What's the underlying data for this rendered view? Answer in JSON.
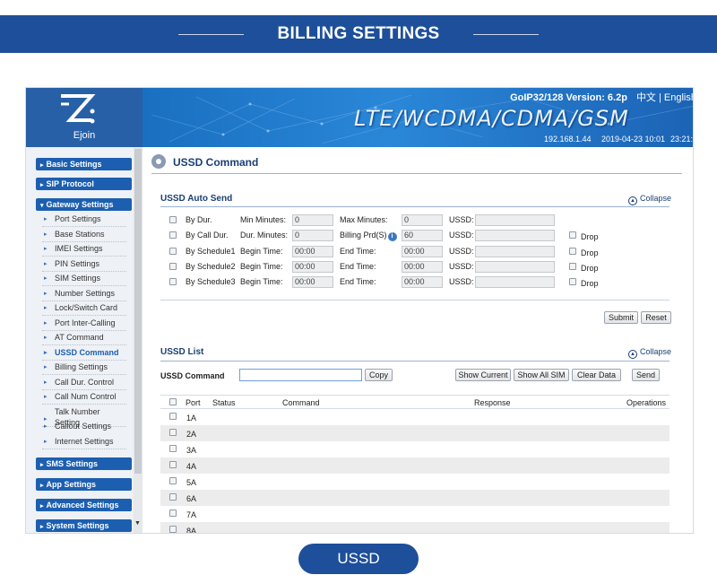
{
  "banner": {
    "title": "BILLING SETTINGS"
  },
  "footer_pill": {
    "label": "USSD"
  },
  "logo": {
    "name": "Ejoin"
  },
  "header": {
    "version": "GoIP32/128 Version: 6.2p",
    "lang": "中文 | English",
    "tech": "LTE/WCDMA/CDMA/GSM",
    "ip": "192.168.1.44",
    "date": "2019-04-23 10:01",
    "time": "23:21:"
  },
  "sidebar": {
    "categories": {
      "basic": "Basic Settings",
      "sip": "SIP Protocol",
      "gateway": "Gateway Settings",
      "sms": "SMS Settings",
      "app": "App Settings",
      "advanced": "Advanced Settings",
      "system": "System Settings"
    },
    "items": [
      "Port Settings",
      "Base Stations",
      "IMEI Settings",
      "PIN Settings",
      "SIM Settings",
      "Number Settings",
      "Lock/Switch Card",
      "Port Inter-Calling",
      "AT Command",
      "USSD Command",
      "Billing Settings",
      "Call Dur. Control",
      "Call Num Control",
      "Talk Number",
      "Setting",
      "Callout Settings",
      "Internet Settings"
    ]
  },
  "main": {
    "title": "USSD Command",
    "auto_send": {
      "title": "USSD Auto Send",
      "collapse": "Collapse",
      "rows": [
        {
          "name": "By Dur.",
          "l1": "Min Minutes:",
          "v1": "0",
          "l2": "Max Minutes:",
          "v2": "0",
          "ussd": "USSD:",
          "drop": ""
        },
        {
          "name": "By Call Dur.",
          "l1": "Dur. Minutes:",
          "v1": "0",
          "l2": "Billing Prd(S)",
          "v2": "60",
          "ussd": "USSD:",
          "drop": "Drop"
        },
        {
          "name": "By Schedule1",
          "l1": "Begin Time:",
          "v1": "00:00",
          "l2": "End Time:",
          "v2": "00:00",
          "ussd": "USSD:",
          "drop": "Drop"
        },
        {
          "name": "By Schedule2",
          "l1": "Begin Time:",
          "v1": "00:00",
          "l2": "End Time:",
          "v2": "00:00",
          "ussd": "USSD:",
          "drop": "Drop"
        },
        {
          "name": "By Schedule3",
          "l1": "Begin Time:",
          "v1": "00:00",
          "l2": "End Time:",
          "v2": "00:00",
          "ussd": "USSD:",
          "drop": "Drop"
        }
      ],
      "submit": "Submit",
      "reset": "Reset"
    },
    "list": {
      "title": "USSD List",
      "collapse": "Collapse",
      "command_label": "USSD Command",
      "command_value": "",
      "copy": "Copy",
      "show_current": "Show Current",
      "show_all": "Show All SIM",
      "clear": "Clear Data",
      "send": "Send",
      "columns": {
        "port": "Port",
        "status": "Status",
        "command": "Command",
        "response": "Response",
        "operations": "Operations"
      },
      "ports": [
        "1A",
        "2A",
        "3A",
        "4A",
        "5A",
        "6A",
        "7A",
        "8A"
      ]
    }
  },
  "colors": {
    "brand": "#1d4f9a",
    "nav": "#1c5fb1",
    "heading": "#1a3f73"
  }
}
